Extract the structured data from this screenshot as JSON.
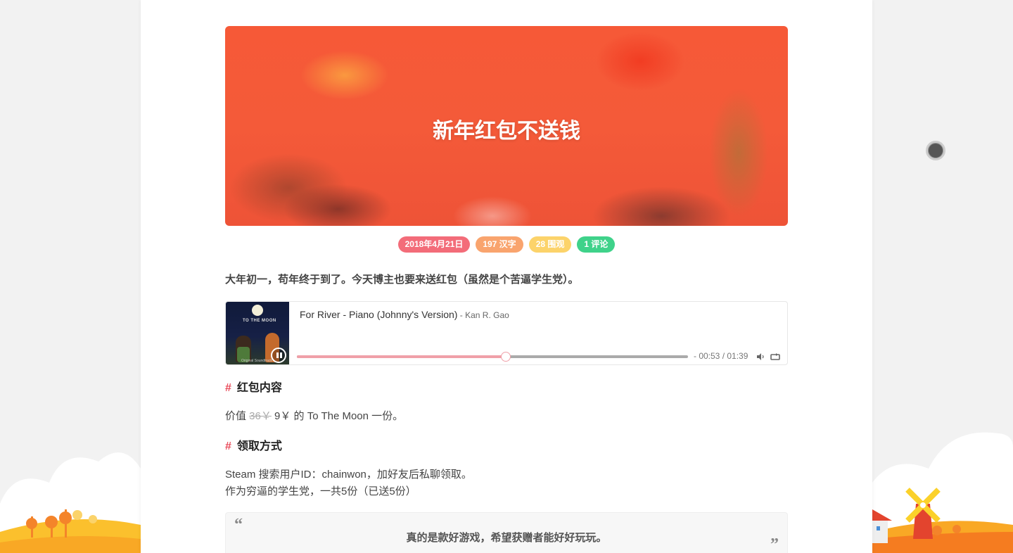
{
  "post": {
    "cover_title": "新年红包不送钱",
    "badges": [
      {
        "text": "2018年4月21日",
        "color": "#f36c79"
      },
      {
        "text": "197 汉字",
        "color": "#f9a46e"
      },
      {
        "text": "28 围观",
        "color": "#fcd36a"
      },
      {
        "text": "1 评论",
        "color": "#3fd28a"
      }
    ],
    "intro": "大年初一，苟年终于到了。今天博主也要来送红包（虽然是个苦逼学生党）。"
  },
  "player": {
    "album_title": "TO THE MOON",
    "album_subtitle": "Original Soundtrack",
    "track_title": "For River - Piano (Johnny's Version)",
    "track_artist": " - Kan R. Gao",
    "current_time": "00:53",
    "total_time": "01:39",
    "time_display": "- 00:53 / 01:39",
    "progress": 0.535,
    "state": "playing"
  },
  "section1": {
    "hash": "#",
    "heading": "红包内容",
    "prefix": "价值 ",
    "old_price": "36￥",
    "new_price": " 9￥ 的 To The Moon 一份。"
  },
  "section2": {
    "hash": "#",
    "heading": "领取方式",
    "line1": "Steam 搜索用户ID：chainwon，加好友后私聊领取。",
    "line2": "作为穷逼的学生党，一共5份（已送5份）"
  },
  "quote": {
    "open_mark": "“",
    "text": "真的是款好游戏，希望获赠者能好好玩玩。",
    "close_mark": "”"
  }
}
